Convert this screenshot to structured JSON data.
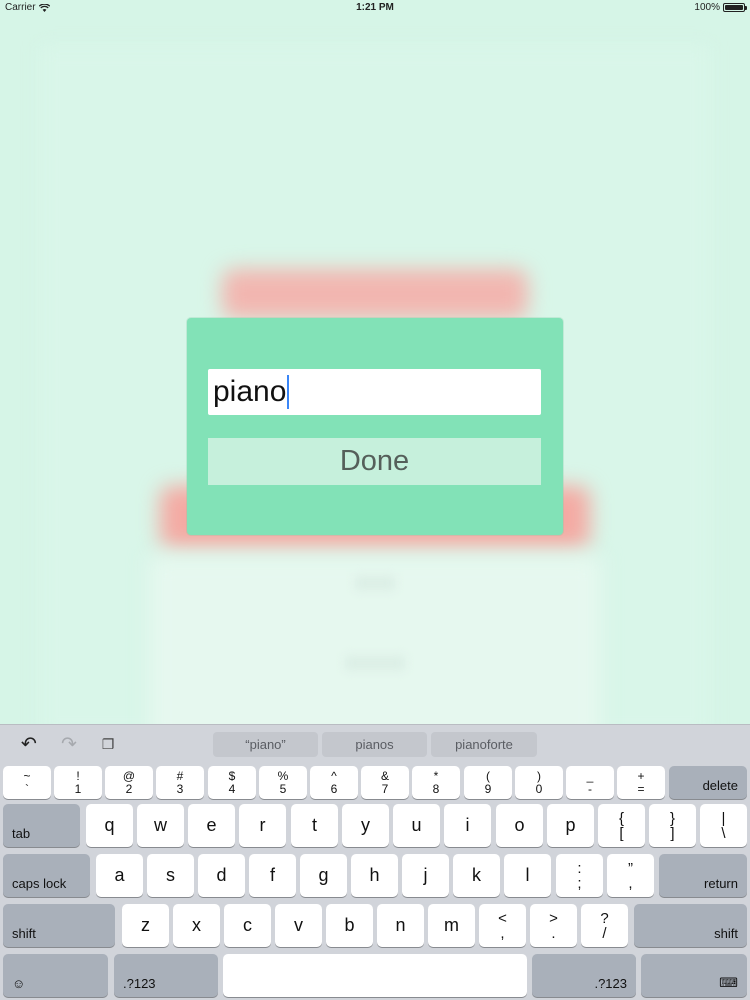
{
  "status_bar": {
    "carrier": "Carrier",
    "time": "1:21 PM",
    "battery": "100%"
  },
  "modal": {
    "text_field_value": "piano",
    "done_label": "Done",
    "background_color": "#82e2b7"
  },
  "keyboard": {
    "toolbar": {
      "suggestions": [
        "“piano”",
        "pianos",
        "pianoforte"
      ]
    },
    "row1": [
      {
        "top": "~",
        "bottom": "`"
      },
      {
        "top": "!",
        "bottom": "1"
      },
      {
        "top": "@",
        "bottom": "2"
      },
      {
        "top": "#",
        "bottom": "3"
      },
      {
        "top": "$",
        "bottom": "4"
      },
      {
        "top": "%",
        "bottom": "5"
      },
      {
        "top": "^",
        "bottom": "6"
      },
      {
        "top": "&",
        "bottom": "7"
      },
      {
        "top": "*",
        "bottom": "8"
      },
      {
        "top": "(",
        "bottom": "9"
      },
      {
        "top": ")",
        "bottom": "0"
      },
      {
        "top": "_",
        "bottom": "-"
      },
      {
        "top": "+",
        "bottom": "="
      }
    ],
    "delete_label": "delete",
    "tab_label": "tab",
    "row2_letters": [
      "q",
      "w",
      "e",
      "r",
      "t",
      "y",
      "u",
      "i",
      "o",
      "p"
    ],
    "row2_symbols": [
      {
        "top": "{",
        "bottom": "["
      },
      {
        "top": "}",
        "bottom": "]"
      },
      {
        "top": "|",
        "bottom": "\\"
      }
    ],
    "caps_lock_label": "caps lock",
    "row3_letters": [
      "a",
      "s",
      "d",
      "f",
      "g",
      "h",
      "j",
      "k",
      "l"
    ],
    "row3_symbols": [
      {
        "top": ":",
        "bottom": ";"
      },
      {
        "top": "”",
        "bottom": ","
      }
    ],
    "return_label": "return",
    "shift_label": "shift",
    "row4_letters": [
      "z",
      "x",
      "c",
      "v",
      "b",
      "n",
      "m"
    ],
    "row4_symbols": [
      {
        "top": "<",
        "bottom": ","
      },
      {
        "top": ">",
        "bottom": "."
      },
      {
        "top": "?",
        "bottom": "/"
      }
    ],
    "numbers_label": ".?123",
    "emoji_glyph": "☺",
    "hide_keyboard_glyph": "⌨"
  }
}
